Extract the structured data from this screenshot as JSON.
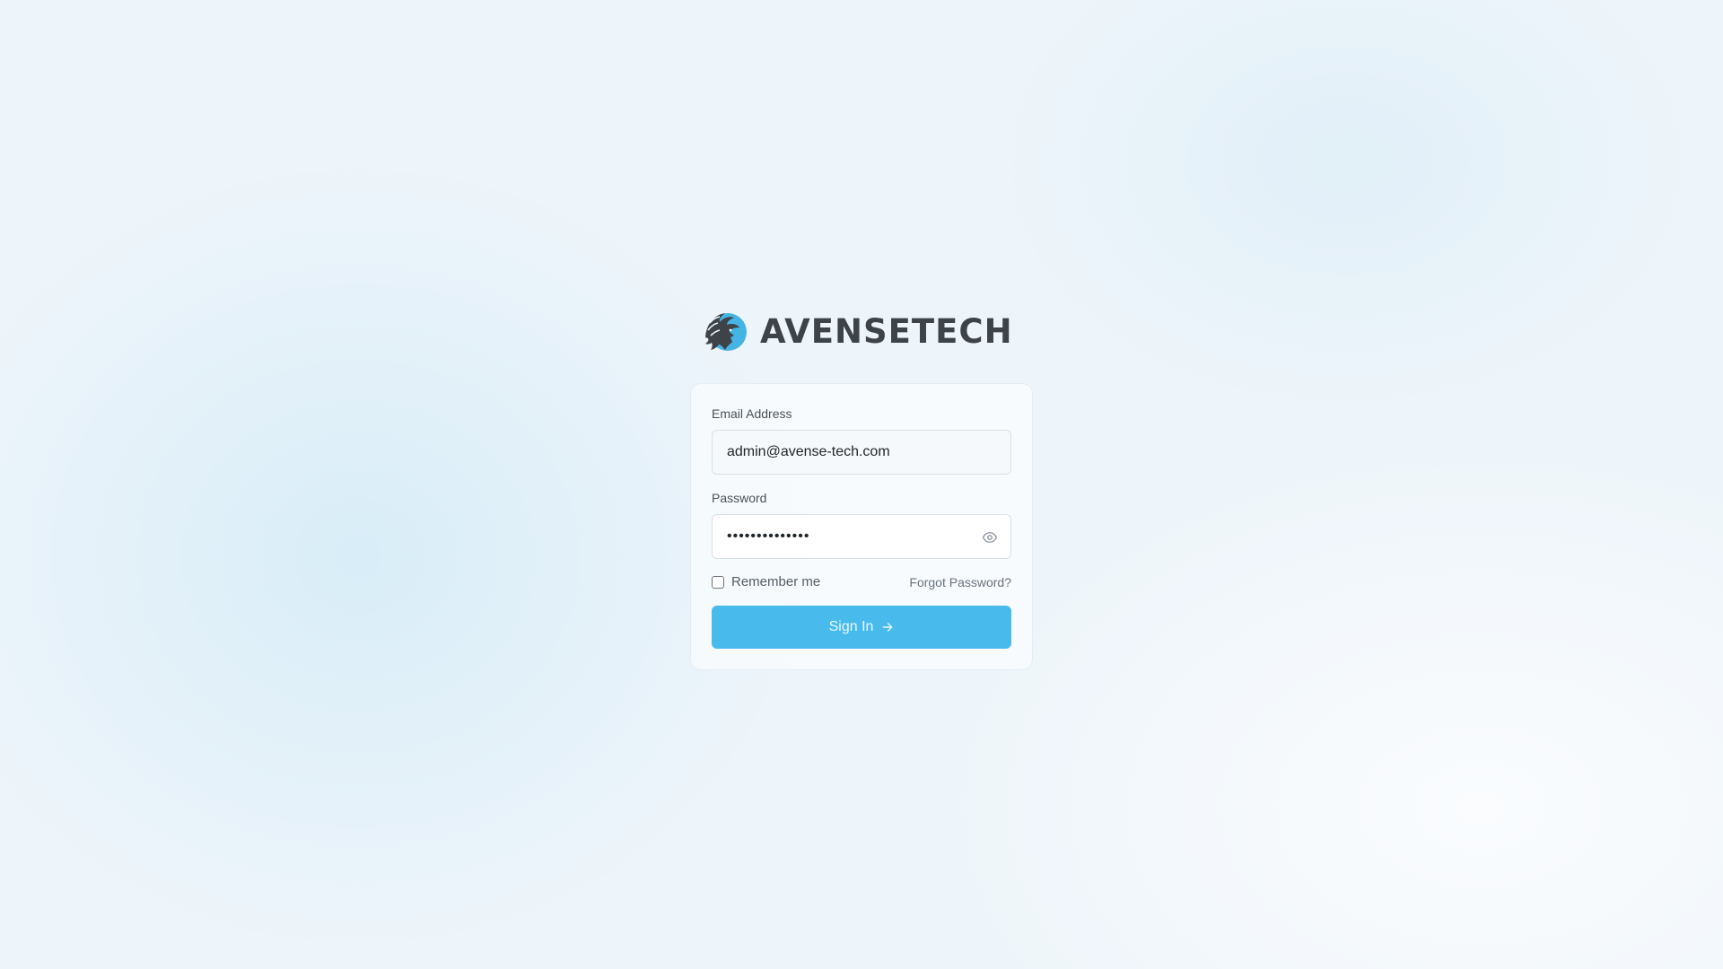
{
  "brand": {
    "name": "AVENSETECH",
    "logo_icon": "lion-head-icon"
  },
  "login_form": {
    "email_label": "Email Address",
    "email_value": "admin@avense-tech.com",
    "password_label": "Password",
    "password_value": "••••••••••••••",
    "password_toggle_icon": "eye-icon",
    "remember_label": "Remember me",
    "remember_checked": false,
    "forgot_label": "Forgot Password?",
    "submit_label": "Sign In",
    "submit_icon": "arrow-right-icon"
  },
  "colors": {
    "accent": "#48bbec",
    "wordmark": "#3d4349",
    "logo_blue": "#45b4e4"
  }
}
